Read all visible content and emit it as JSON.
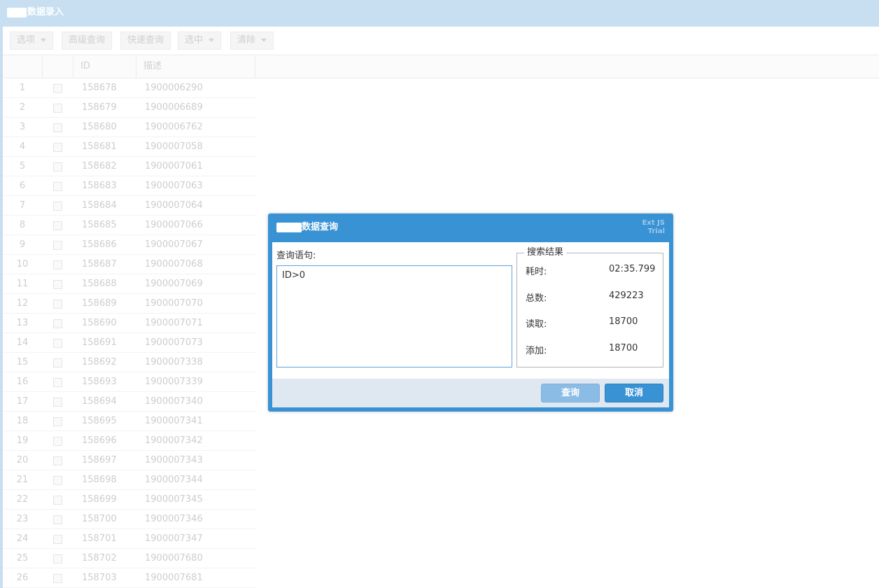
{
  "panel": {
    "title": "数据录入"
  },
  "toolbar": {
    "options": "选项",
    "advanced_query": "高级查询",
    "quick_query": "快速查询",
    "select": "选中",
    "clear": "清除"
  },
  "grid": {
    "columns": [
      "ID",
      "描述"
    ],
    "rows": [
      {
        "n": "1",
        "id": "158678",
        "desc": "1900006290"
      },
      {
        "n": "2",
        "id": "158679",
        "desc": "1900006689"
      },
      {
        "n": "3",
        "id": "158680",
        "desc": "1900006762"
      },
      {
        "n": "4",
        "id": "158681",
        "desc": "1900007058"
      },
      {
        "n": "5",
        "id": "158682",
        "desc": "1900007061"
      },
      {
        "n": "6",
        "id": "158683",
        "desc": "1900007063"
      },
      {
        "n": "7",
        "id": "158684",
        "desc": "1900007064"
      },
      {
        "n": "8",
        "id": "158685",
        "desc": "1900007066"
      },
      {
        "n": "9",
        "id": "158686",
        "desc": "1900007067"
      },
      {
        "n": "10",
        "id": "158687",
        "desc": "1900007068"
      },
      {
        "n": "11",
        "id": "158688",
        "desc": "1900007069"
      },
      {
        "n": "12",
        "id": "158689",
        "desc": "1900007070"
      },
      {
        "n": "13",
        "id": "158690",
        "desc": "1900007071"
      },
      {
        "n": "14",
        "id": "158691",
        "desc": "1900007073"
      },
      {
        "n": "15",
        "id": "158692",
        "desc": "1900007338"
      },
      {
        "n": "16",
        "id": "158693",
        "desc": "1900007339"
      },
      {
        "n": "17",
        "id": "158694",
        "desc": "1900007340"
      },
      {
        "n": "18",
        "id": "158695",
        "desc": "1900007341"
      },
      {
        "n": "19",
        "id": "158696",
        "desc": "1900007342"
      },
      {
        "n": "20",
        "id": "158697",
        "desc": "1900007343"
      },
      {
        "n": "21",
        "id": "158698",
        "desc": "1900007344"
      },
      {
        "n": "22",
        "id": "158699",
        "desc": "1900007345"
      },
      {
        "n": "23",
        "id": "158700",
        "desc": "1900007346"
      },
      {
        "n": "24",
        "id": "158701",
        "desc": "1900007347"
      },
      {
        "n": "25",
        "id": "158702",
        "desc": "1900007680"
      },
      {
        "n": "26",
        "id": "158703",
        "desc": "1900007681"
      }
    ]
  },
  "dialog": {
    "title": "数据查询",
    "trial_line1": "Ext JS",
    "trial_line2": "Trial",
    "query_label": "查询语句:",
    "query_value": "ID>0",
    "results_legend": "搜索结果",
    "elapsed_label": "耗时:",
    "elapsed_value": "02:35.799",
    "total_label": "总数:",
    "total_value": "429223",
    "read_label": "读取:",
    "read_value": "18700",
    "added_label": "添加:",
    "added_value": "18700",
    "query_button": "查询",
    "cancel_button": "取消"
  }
}
